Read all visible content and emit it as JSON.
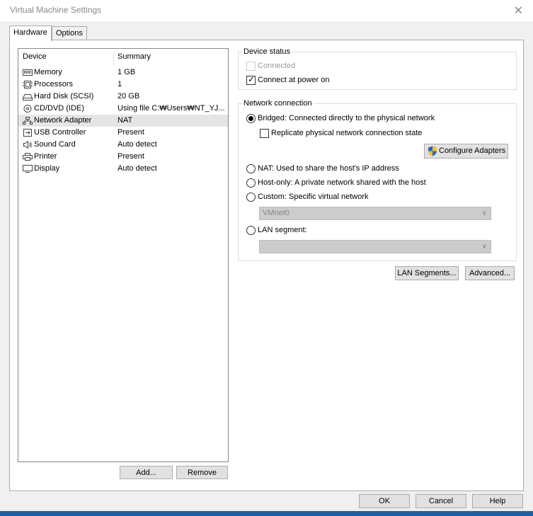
{
  "window": {
    "title": "Virtual Machine Settings",
    "close_glyph": "✕"
  },
  "tabs": [
    {
      "label": "Hardware",
      "active": true
    },
    {
      "label": "Options",
      "active": false
    }
  ],
  "device_list": {
    "columns": [
      "Device",
      "Summary"
    ],
    "rows": [
      {
        "icon": "memory-icon",
        "name": "Memory",
        "summary": "1 GB"
      },
      {
        "icon": "processor-icon",
        "name": "Processors",
        "summary": "1"
      },
      {
        "icon": "hard-disk-icon",
        "name": "Hard Disk (SCSI)",
        "summary": "20 GB"
      },
      {
        "icon": "cd-dvd-icon",
        "name": "CD/DVD (IDE)",
        "summary": "Using file C:₩Users₩NT_YJ..."
      },
      {
        "icon": "network-adapter-icon",
        "name": "Network Adapter",
        "summary": "NAT",
        "selected": true
      },
      {
        "icon": "usb-controller-icon",
        "name": "USB Controller",
        "summary": "Present"
      },
      {
        "icon": "sound-card-icon",
        "name": "Sound Card",
        "summary": "Auto detect"
      },
      {
        "icon": "printer-icon",
        "name": "Printer",
        "summary": "Present"
      },
      {
        "icon": "display-icon",
        "name": "Display",
        "summary": "Auto detect"
      }
    ],
    "add_label": "Add...",
    "remove_label": "Remove"
  },
  "device_status": {
    "label": "Device status",
    "connected_label": "Connected",
    "connected_checked": false,
    "connect_power_label": "Connect at power on",
    "connect_power_checked": true
  },
  "network_connection": {
    "label": "Network connection",
    "bridged_label": "Bridged: Connected directly to the physical network",
    "replicate_label": "Replicate physical network connection state",
    "configure_label": "Configure Adapters",
    "nat_label": "NAT: Used to share the host's IP address",
    "hostonly_label": "Host-only: A private network shared with the host",
    "custom_label": "Custom: Specific virtual network",
    "custom_value": "VMnet0",
    "lan_label": "LAN segment:",
    "lan_value": "",
    "selected": "bridged"
  },
  "network_buttons": {
    "lan_segments": "LAN Segments...",
    "advanced": "Advanced..."
  },
  "footer": {
    "ok": "OK",
    "cancel": "Cancel",
    "help": "Help"
  },
  "colors": {
    "shield_blue": "#2a63c8",
    "shield_yellow": "#f3c316"
  }
}
